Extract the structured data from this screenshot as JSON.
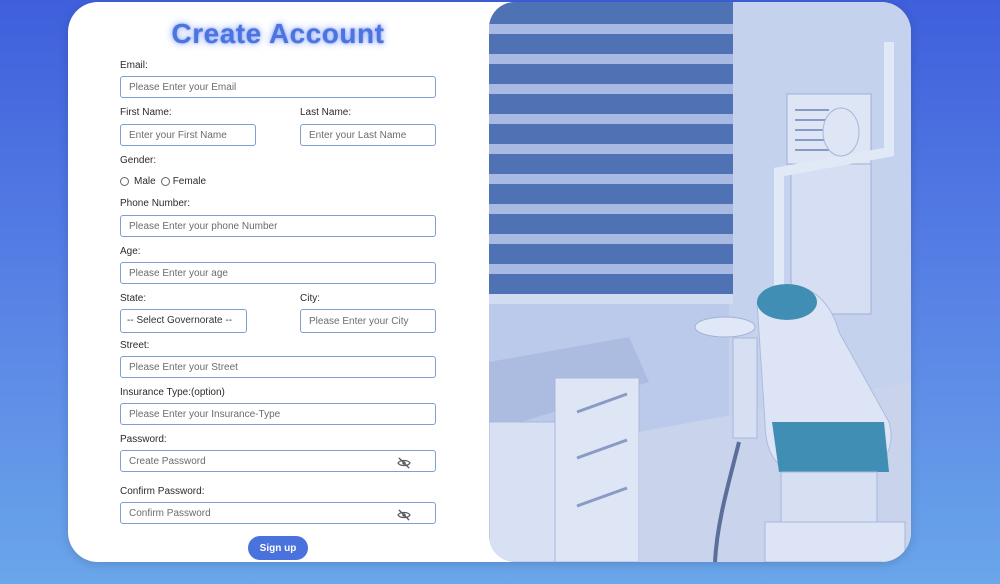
{
  "form": {
    "title": "Create Account",
    "email": {
      "label": "Email:",
      "placeholder": "Please Enter your Email"
    },
    "first_name": {
      "label": "First Name:",
      "placeholder": "Enter your First Name"
    },
    "last_name": {
      "label": "Last Name:",
      "placeholder": "Enter your Last Name"
    },
    "gender": {
      "label": "Gender:",
      "options": [
        "Male",
        "Female"
      ]
    },
    "phone": {
      "label": "Phone Number:",
      "placeholder": "Please Enter your phone Number"
    },
    "age": {
      "label": "Age:",
      "placeholder": "Please Enter your age"
    },
    "state": {
      "label": "State:",
      "selected": "-- Select Governorate --"
    },
    "city": {
      "label": "City:",
      "placeholder": "Please Enter your City"
    },
    "street": {
      "label": "Street:",
      "placeholder": "Please Enter your Street"
    },
    "insurance": {
      "label": "Insurance Type:(option)",
      "placeholder": "Please Enter your Insurance-Type"
    },
    "password": {
      "label": "Password:",
      "placeholder": "Create Password"
    },
    "confirm_password": {
      "label": "Confirm Password:",
      "placeholder": "Confirm Password"
    },
    "submit_label": "Sign up"
  },
  "icons": {
    "password_toggle": "eye-slash-icon",
    "confirm_toggle": "eye-slash-icon"
  },
  "colors": {
    "accent": "#4a72dc",
    "title": "#4b74dc",
    "input_border": "#7e9fd6"
  }
}
